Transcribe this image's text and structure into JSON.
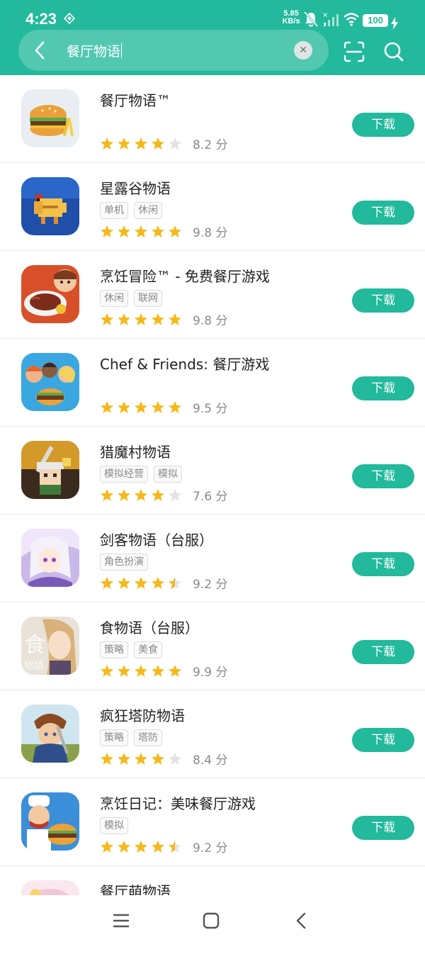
{
  "status": {
    "time": "4:23",
    "net_speed_value": "5.85",
    "net_speed_unit": "KB/s",
    "battery": "100"
  },
  "search": {
    "query": "餐厅物语",
    "clear_icon": "close-icon"
  },
  "apps": [
    {
      "name": "餐厅物语™",
      "tags": [],
      "rating": 8.2,
      "score": "8.2 分",
      "stars": 4,
      "download": "下载"
    },
    {
      "name": "星露谷物语",
      "tags": [
        "单机",
        "休闲"
      ],
      "rating": 9.8,
      "score": "9.8 分",
      "stars": 5,
      "download": "下载"
    },
    {
      "name": "烹饪冒险™ - 免费餐厅游戏",
      "tags": [
        "休闲",
        "联网"
      ],
      "rating": 9.8,
      "score": "9.8 分",
      "stars": 5,
      "download": "下载"
    },
    {
      "name": "Chef & Friends: 餐厅游戏",
      "tags": [],
      "rating": 9.5,
      "score": "9.5 分",
      "stars": 5,
      "download": "下载"
    },
    {
      "name": "猎魔村物语",
      "tags": [
        "模拟经营",
        "模拟"
      ],
      "rating": 7.6,
      "score": "7.6 分",
      "stars": 4,
      "download": "下载"
    },
    {
      "name": "剑客物语（台服）",
      "tags": [
        "角色扮演"
      ],
      "rating": 9.2,
      "score": "9.2 分",
      "stars": 4.5,
      "download": "下载"
    },
    {
      "name": "食物语（台服）",
      "tags": [
        "策略",
        "美食"
      ],
      "rating": 9.9,
      "score": "9.9 分",
      "stars": 5,
      "download": "下载"
    },
    {
      "name": "疯狂塔防物语",
      "tags": [
        "策略",
        "塔防"
      ],
      "rating": 8.4,
      "score": "8.4 分",
      "stars": 4,
      "download": "下载"
    },
    {
      "name": "烹饪日记：美味餐厅游戏",
      "tags": [
        "模拟"
      ],
      "rating": 9.2,
      "score": "9.2 分",
      "stars": 4.5,
      "download": "下载"
    },
    {
      "name": "餐厅萌物语",
      "tags": [],
      "rating": null,
      "score": "",
      "stars": 0,
      "download": ""
    }
  ],
  "colors": {
    "accent": "#22b99c",
    "star": "#f6b91b",
    "star_empty": "#e3e3e3"
  }
}
